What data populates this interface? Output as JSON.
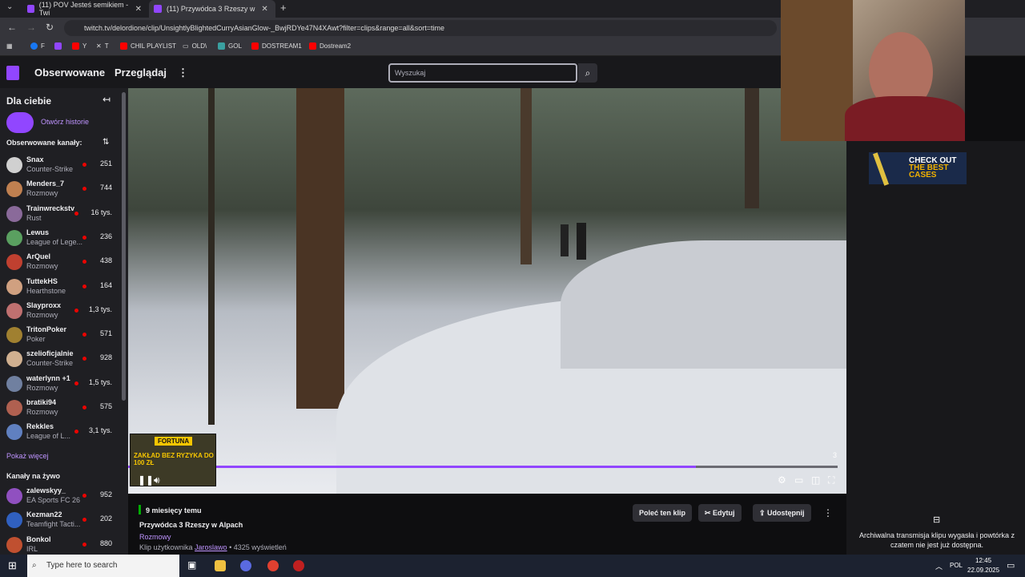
{
  "browser": {
    "tabs": [
      {
        "title": "(11) POV Jesteś semikiem - Twi",
        "active": false
      },
      {
        "title": "(11) Przywódca 3 Rzeszy w",
        "active": true
      }
    ],
    "url": "twitch.tv/delordione/clip/UnsightlyBlightedCurryAsianGlow-_BwjRDYe47N4XAwt?filter=clips&range=all&sort=time",
    "bookmarks": [
      "F",
      "",
      "Y",
      "T",
      "CHIL PLAYLIST",
      "OLD\\",
      "GOL",
      "DOSTREAM1",
      "Dostream2"
    ]
  },
  "nav": {
    "following": "Obserwowane",
    "browse": "Przeglądaj",
    "search_placeholder": "Wyszukaj"
  },
  "sidebar": {
    "for_you": "Dla ciebie",
    "stories": "Otwórz historie",
    "followed_header": "Obserwowane kanały:",
    "followed": [
      {
        "name": "Snax",
        "category": "Counter-Strike",
        "viewers": "251",
        "color": "#d0d0d0"
      },
      {
        "name": "Menders_7",
        "category": "Rozmowy",
        "viewers": "744",
        "color": "#c08050"
      },
      {
        "name": "Trainwreckstv",
        "category": "Rust",
        "viewers": "16 tys.",
        "color": "#8a6a9a"
      },
      {
        "name": "Lewus",
        "category": "League of Lege...",
        "viewers": "236",
        "color": "#5aa060"
      },
      {
        "name": "ArQuel",
        "category": "Rozmowy",
        "viewers": "438",
        "color": "#c04030"
      },
      {
        "name": "TuttekHS",
        "category": "Hearthstone",
        "viewers": "164",
        "color": "#d0a080"
      },
      {
        "name": "Slayproxx",
        "category": "Rozmowy",
        "viewers": "1,3 tys.",
        "color": "#c07070"
      },
      {
        "name": "TritonPoker",
        "category": "Poker",
        "viewers": "571",
        "color": "#a08030"
      },
      {
        "name": "szelioficjalnie",
        "category": "Counter-Strike",
        "viewers": "928",
        "color": "#d0b090"
      },
      {
        "name": "waterlynn +1",
        "category": "Rozmowy",
        "viewers": "1,5 tys.",
        "color": "#7080a0"
      },
      {
        "name": "bratiki94",
        "category": "Rozmowy",
        "viewers": "575",
        "color": "#b06050"
      },
      {
        "name": "Rekkles",
        "category": "League of L...",
        "viewers": "3,1 tys.",
        "color": "#6080c0"
      }
    ],
    "show_more": "Pokaż więcej",
    "live_header": "Kanały na żywo",
    "live": [
      {
        "name": "zalewskyy_",
        "category": "EA Sports FC 26",
        "viewers": "952",
        "color": "#9050c0"
      },
      {
        "name": "Kezman22",
        "category": "Teamfight Tacti...",
        "viewers": "202",
        "color": "#3060c0"
      },
      {
        "name": "Bonkol",
        "category": "IRL",
        "viewers": "880",
        "color": "#c05030"
      }
    ]
  },
  "player": {
    "counter": "3",
    "progress_fraction": 0.8,
    "ad_badge": "FORTUNA",
    "ad_text": "ZAKŁAD BEZ RYZYKA DO 100 ZŁ"
  },
  "clip": {
    "age": "9 miesięcy temu",
    "title": "Przywódca 3 Rzeszy w Alpach",
    "category": "Rozmowy",
    "by_prefix": "Klip użytkownika",
    "author": "Jaroslawo",
    "views": "• 4325 wyświetleń",
    "btn_recommend": "Poleć ten klip",
    "btn_edit": "Edytuj",
    "btn_share": "Udostępnij"
  },
  "right": {
    "banner_line1": "CHECK OUT",
    "banner_line2": "THE BEST CASES",
    "archive": "Archiwalna transmisja klipu wygasła i powtórka z czatem nie jest już dostępna."
  },
  "taskbar": {
    "search": "Type here to search",
    "lang": "POL",
    "time": "12:45",
    "date": "22.09.2025"
  },
  "colors": {
    "accent": "#9146ff",
    "live": "#eb0400"
  }
}
